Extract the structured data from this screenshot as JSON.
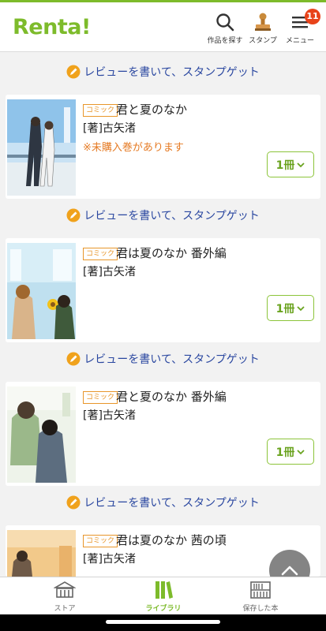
{
  "header": {
    "logo": "Renta!",
    "search_label": "作品を探す",
    "stamp_label": "スタンプ",
    "menu_label": "メニュー",
    "menu_badge": "11",
    "accent": "#7dbb2b"
  },
  "review_text": "レビューを書いて、スタンプゲット",
  "items": [
    {
      "tag": "コミック",
      "title": "君と夏のなか",
      "author": "[著]古矢渚",
      "notice": "※未購入巻があります",
      "volume": "1冊"
    },
    {
      "tag": "コミック",
      "title": "君は夏のなか 番外編",
      "author": "[著]古矢渚",
      "volume": "1冊"
    },
    {
      "tag": "コミック",
      "title": "君と夏のなか 番外編",
      "author": "[著]古矢渚",
      "volume": "1冊"
    },
    {
      "tag": "コミック",
      "title": "君は夏のなか 茜の頃",
      "author": "[著]古矢渚"
    }
  ],
  "tabs": {
    "store": "ストア",
    "library": "ライブラリ",
    "saved": "保存した本"
  }
}
